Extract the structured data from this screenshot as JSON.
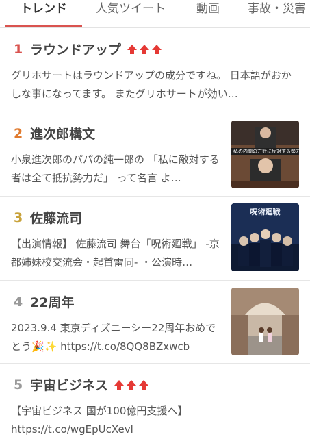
{
  "tabs": [
    {
      "label": "トレンド"
    },
    {
      "label": "人気ツイート"
    },
    {
      "label": "動画"
    },
    {
      "label": "事故・災害"
    }
  ],
  "colors": {
    "accent": "#d9534f",
    "rank1": "#d9534f",
    "rank2": "#e07a2e",
    "rank3": "#c8a23a",
    "rank4": "#999999",
    "rank5": "#999999",
    "arrow": "#e53935"
  },
  "trends": [
    {
      "rank": "1",
      "title": "ラウンドアップ",
      "arrows": 3,
      "text": "グリホサートはラウンドアップの成分ですね。 日本語がおかしな事になってます。 またグリホサートが効い…",
      "thumb": null
    },
    {
      "rank": "2",
      "title": "進次郎構文",
      "arrows": 0,
      "text": "小泉進次郎のパパの純一郎の 「私に敵対する者は全て抵抗勢力だ」 って名言 よ…",
      "thumb": "politician-photo",
      "thumb_caption": "私の内閣の方針に反対する勢力"
    },
    {
      "rank": "3",
      "title": "佐藤流司",
      "arrows": 0,
      "text": "【出演情報】 佐藤流司 舞台「呪術廻戦」 -京都姉妹校交流会・起首雷同- ・公演時…",
      "thumb": "stage-poster",
      "thumb_caption": "呪術廻戦"
    },
    {
      "rank": "4",
      "title": "22周年",
      "arrows": 0,
      "text": "2023.9.4 東京ディズニーシー22周年おめでとう🎉✨ https://t.co/8QQ8BZxwcb",
      "thumb": "park-photo"
    },
    {
      "rank": "5",
      "title": "宇宙ビジネス",
      "arrows": 3,
      "text": "【宇宙ビジネス 国が100億円支援へ】 https://t.co/wgEpUcXevl",
      "thumb": null
    }
  ]
}
